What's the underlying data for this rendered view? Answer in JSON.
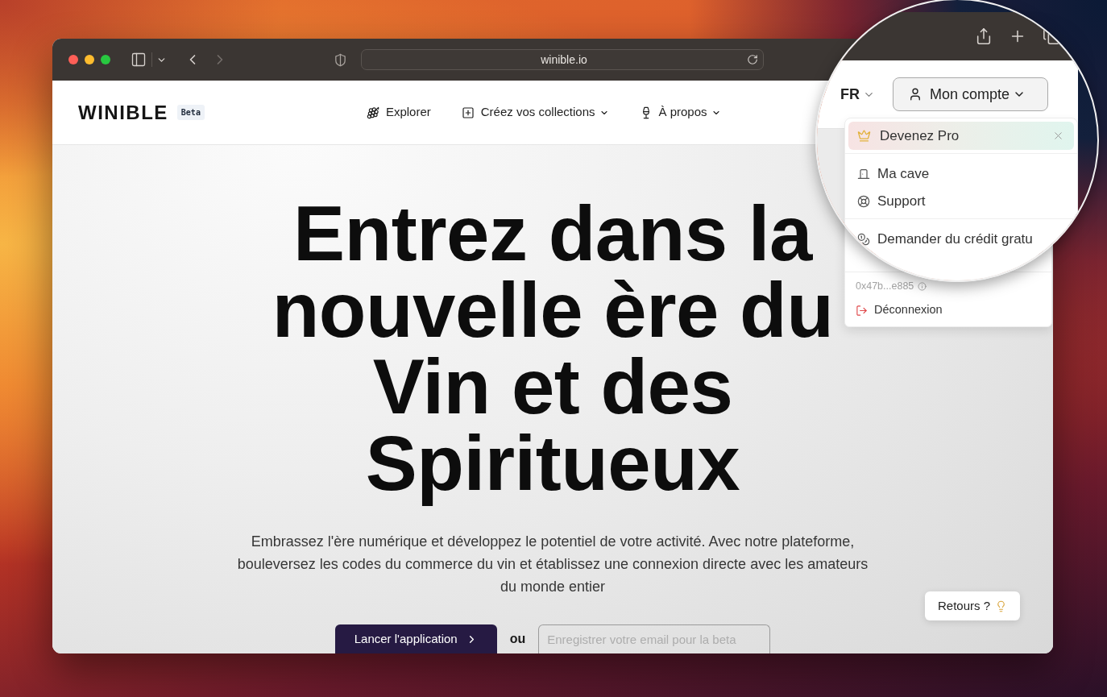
{
  "browser": {
    "url": "winible.io"
  },
  "site_header": {
    "logo": "WINIBLE",
    "badge": "Beta",
    "nav": [
      {
        "label": "Explorer",
        "has_menu": false
      },
      {
        "label": "Créez vos collections",
        "has_menu": true
      },
      {
        "label": "À propos",
        "has_menu": true
      }
    ]
  },
  "hero": {
    "title": "Entrez dans la nouvelle ère du Vin et des Spiritueux",
    "description": "Embrassez l'ère numérique et développez le potentiel de votre activité. Avec notre plateforme, bouleversez les codes du commerce du vin et établissez une connexion directe avec les amateurs du monde entier",
    "cta": "Lancer l'application",
    "separator": "ou",
    "email_placeholder": "Enregistrer votre email pour la beta"
  },
  "feedback_button": {
    "label": "Retours ?"
  },
  "account_menu": {
    "address": "0x47b...e885",
    "logout": "Déconnexion"
  },
  "magnifier": {
    "language": "FR",
    "account_button": "Mon compte",
    "promo": "Devenez Pro",
    "menu_groups": [
      {
        "items": [
          "Ma cave",
          "Support"
        ]
      },
      {
        "items": [
          "Demander du crédit gratu"
        ]
      }
    ]
  }
}
